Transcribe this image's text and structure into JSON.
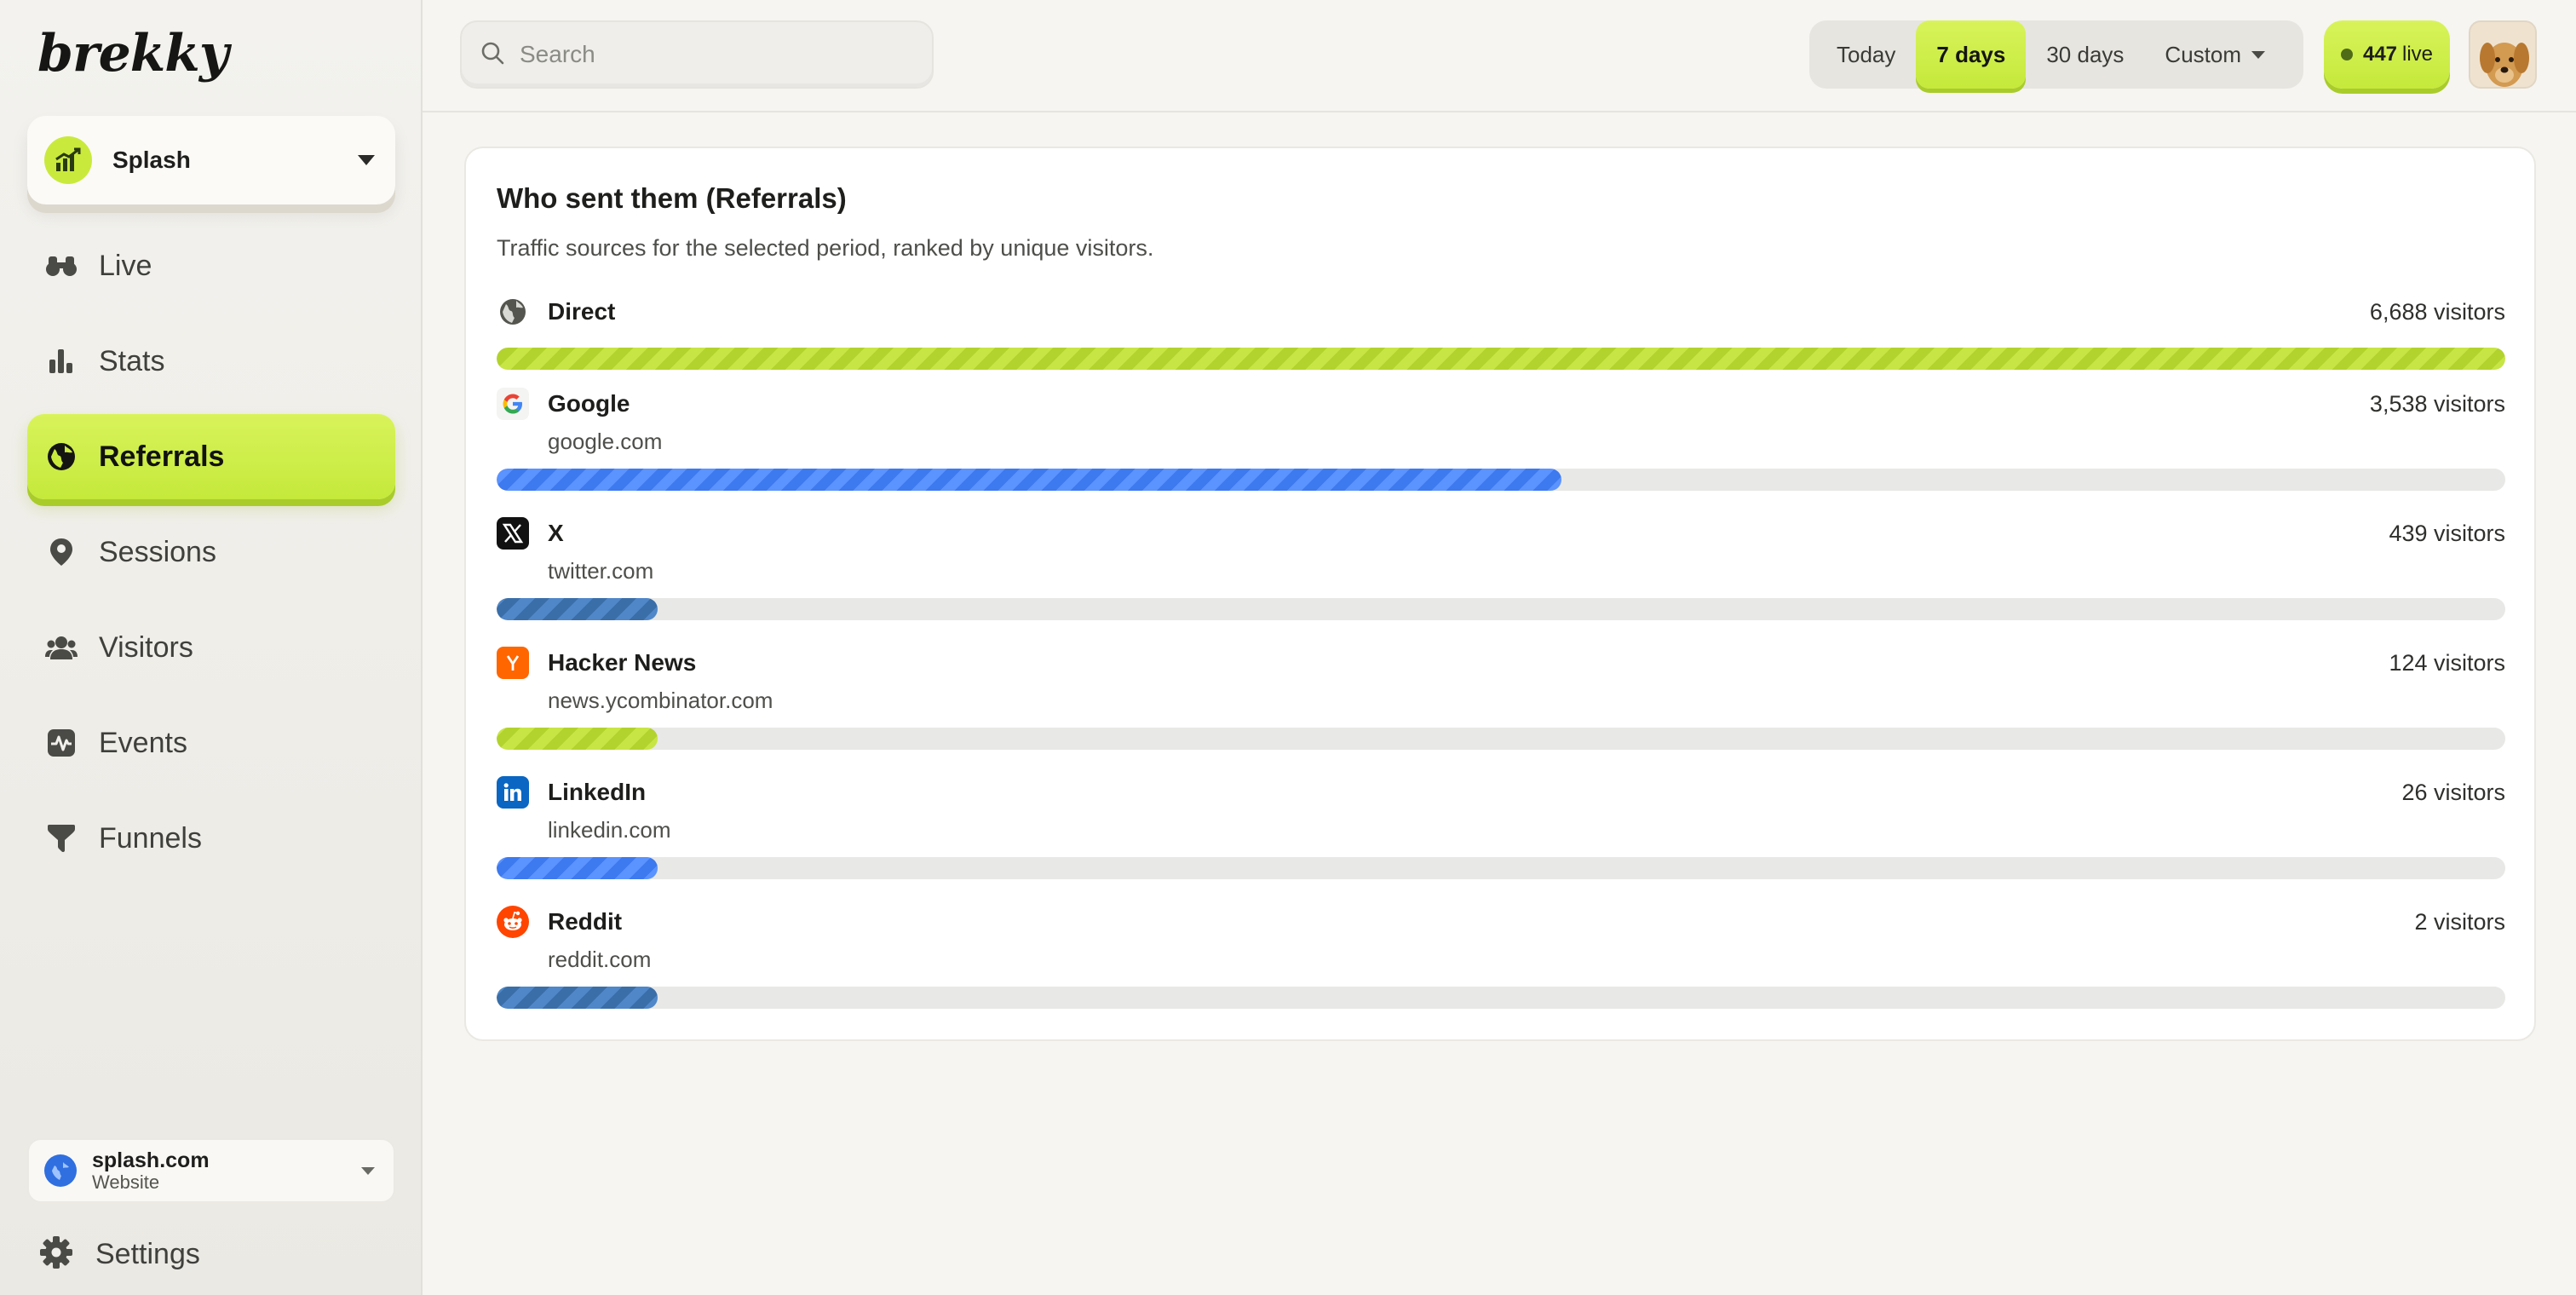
{
  "app": {
    "logo_text": "brekky"
  },
  "project": {
    "name": "Splash"
  },
  "nav": {
    "items": [
      {
        "id": "live",
        "label": "Live",
        "icon": "binoculars-icon",
        "active": false
      },
      {
        "id": "stats",
        "label": "Stats",
        "icon": "bar-chart-icon",
        "active": false
      },
      {
        "id": "referrals",
        "label": "Referrals",
        "icon": "globe-icon",
        "active": true
      },
      {
        "id": "sessions",
        "label": "Sessions",
        "icon": "map-pin-icon",
        "active": false
      },
      {
        "id": "visitors",
        "label": "Visitors",
        "icon": "users-icon",
        "active": false
      },
      {
        "id": "events",
        "label": "Events",
        "icon": "activity-icon",
        "active": false
      },
      {
        "id": "funnels",
        "label": "Funnels",
        "icon": "funnel-icon",
        "active": false
      }
    ],
    "settings_label": "Settings"
  },
  "site": {
    "name": "splash.com",
    "type": "Website"
  },
  "search": {
    "placeholder": "Search",
    "value": ""
  },
  "date_range": {
    "options": [
      "Today",
      "7 days",
      "30 days",
      "Custom"
    ],
    "selected": "7 days"
  },
  "live": {
    "count": "447",
    "label": "live"
  },
  "referrals": {
    "title": "Who sent them (Referrals)",
    "subtitle": "Traffic sources for the selected period, ranked by unique visitors.",
    "items": [
      {
        "name": "Direct",
        "domain": "",
        "count_text": "6,688 visitors",
        "visitors": 6688,
        "share": 1.0,
        "color": "lime",
        "icon": "globe-icon"
      },
      {
        "name": "Google",
        "domain": "google.com",
        "count_text": "3,538 visitors",
        "visitors": 3538,
        "share": 0.53,
        "color": "blue",
        "icon": "google-icon"
      },
      {
        "name": "X",
        "domain": "twitter.com",
        "count_text": "439 visitors",
        "visitors": 439,
        "share": 0.08,
        "color": "steel",
        "icon": "x-icon"
      },
      {
        "name": "Hacker News",
        "domain": "news.ycombinator.com",
        "count_text": "124 visitors",
        "visitors": 124,
        "share": 0.08,
        "color": "lime",
        "icon": "hacker-news-icon"
      },
      {
        "name": "LinkedIn",
        "domain": "linkedin.com",
        "count_text": "26 visitors",
        "visitors": 26,
        "share": 0.08,
        "color": "blue",
        "icon": "linkedin-icon"
      },
      {
        "name": "Reddit",
        "domain": "reddit.com",
        "count_text": "2 visitors",
        "visitors": 2,
        "share": 0.08,
        "color": "steel",
        "icon": "reddit-icon"
      }
    ]
  },
  "colors": {
    "accent": "#c9ea3c",
    "bar_blue": "#3d79ef",
    "bar_steel": "#3a6ea8",
    "bar_track": "#e8e8e6"
  }
}
